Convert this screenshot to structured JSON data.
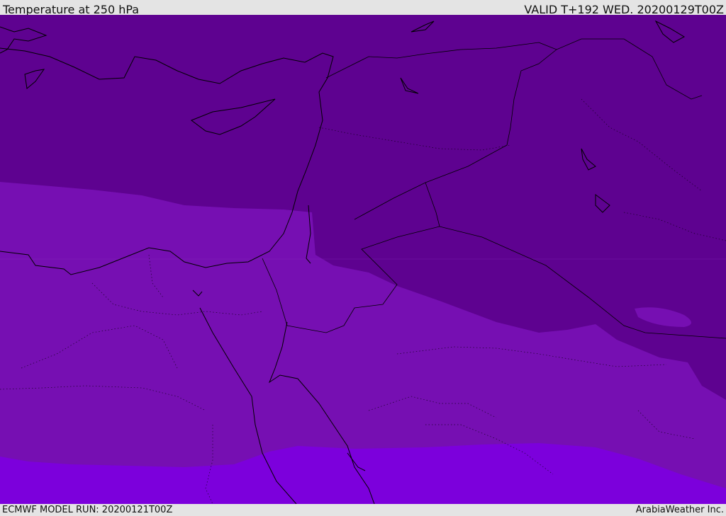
{
  "header": {
    "title": "Temperature at 250 hPa",
    "valid_time": "VALID T+192 WED. 20200129T00Z"
  },
  "footer": {
    "model_run": "ECMWF MODEL RUN: 20200121T00Z",
    "credit": "ArabiaWeather Inc."
  },
  "map": {
    "variable": "temperature",
    "level": "250 hPa",
    "colors": {
      "coldest_band": "#5e0290",
      "mid_band": "#760fb2",
      "warmest_band": "#7c00dc",
      "coastline": "#000000"
    }
  }
}
